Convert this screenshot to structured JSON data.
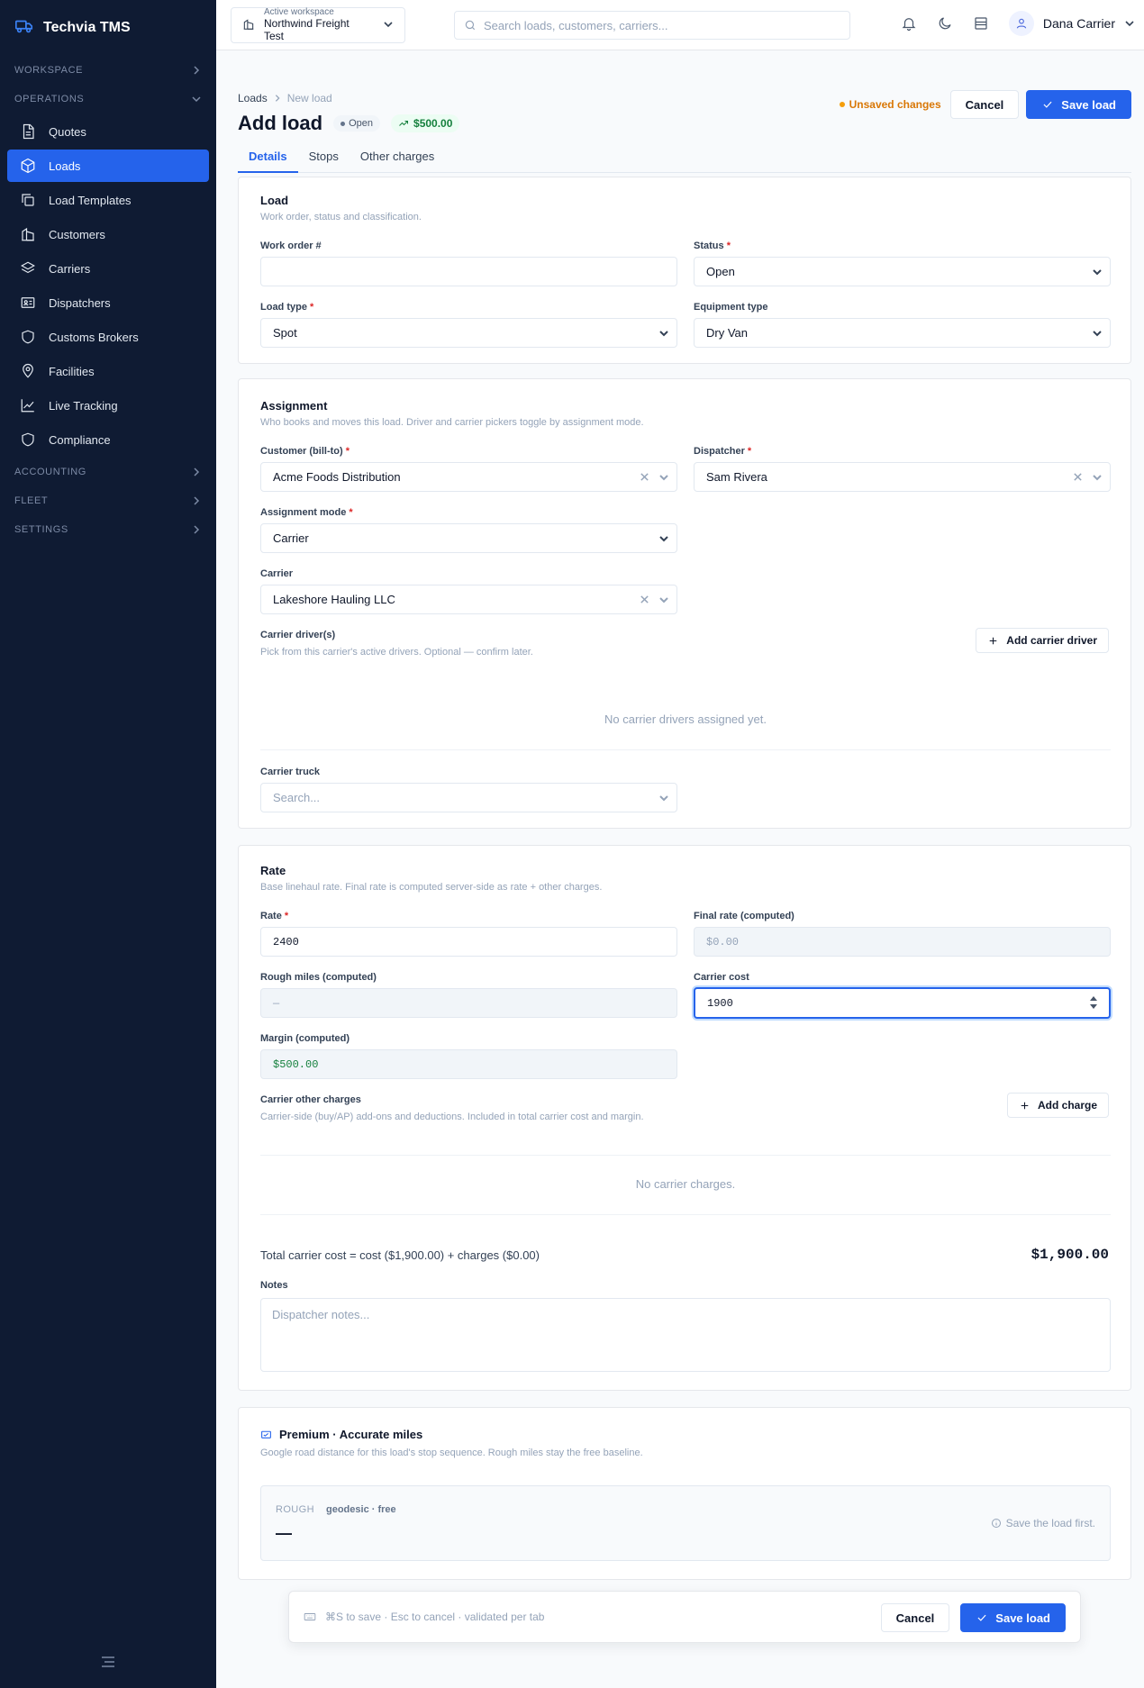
{
  "app": {
    "name": "Techvia TMS"
  },
  "colors": {
    "accent": "#2563eb",
    "sidebar_bg": "#0f1b33",
    "success": "#15803d",
    "warning": "#d97706",
    "required": "#dc2626"
  },
  "sidebar": {
    "sections": {
      "workspace": "WORKSPACE",
      "operations": "OPERATIONS",
      "accounting": "ACCOUNTING",
      "fleet": "FLEET",
      "settings": "SETTINGS"
    },
    "items": [
      {
        "label": "Quotes",
        "icon": "document-icon"
      },
      {
        "label": "Loads",
        "icon": "box-icon",
        "active": true
      },
      {
        "label": "Load Templates",
        "icon": "copy-icon"
      },
      {
        "label": "Customers",
        "icon": "building-icon"
      },
      {
        "label": "Carriers",
        "icon": "layers-icon"
      },
      {
        "label": "Dispatchers",
        "icon": "id-card-icon"
      },
      {
        "label": "Customs Brokers",
        "icon": "shield-icon"
      },
      {
        "label": "Facilities",
        "icon": "map-pin-icon"
      },
      {
        "label": "Live Tracking",
        "icon": "chart-line-icon"
      },
      {
        "label": "Compliance",
        "icon": "shield-icon"
      }
    ]
  },
  "topbar": {
    "workspace_caption": "Active workspace",
    "workspace_name": "Northwind Freight Test",
    "search_placeholder": "Search loads, customers, carriers...",
    "user_name": "Dana Carrier"
  },
  "header": {
    "breadcrumb_root": "Loads",
    "breadcrumb_current": "New load",
    "title": "Add load",
    "status_badge": "Open",
    "margin_badge": "$500.00",
    "unsaved": "Unsaved changes",
    "cancel": "Cancel",
    "save": "Save load"
  },
  "tabs": [
    "Details",
    "Stops",
    "Other charges"
  ],
  "load_section": {
    "title": "Load",
    "subtitle": "Work order, status and classification.",
    "work_order_label": "Work order #",
    "work_order_value": "",
    "status_label": "Status",
    "status_value": "Open",
    "load_type_label": "Load type",
    "load_type_value": "Spot",
    "equipment_label": "Equipment type",
    "equipment_value": "Dry Van"
  },
  "assignment": {
    "title": "Assignment",
    "subtitle": "Who books and moves this load. Driver and carrier pickers toggle by assignment mode.",
    "customer_label": "Customer (bill-to)",
    "customer_value": "Acme Foods Distribution",
    "dispatcher_label": "Dispatcher",
    "dispatcher_value": "Sam Rivera",
    "mode_label": "Assignment mode",
    "mode_value": "Carrier",
    "carrier_label": "Carrier",
    "carrier_value": "Lakeshore Hauling LLC",
    "drivers_label": "Carrier driver(s)",
    "drivers_hint": "Pick from this carrier's active drivers. Optional — confirm later.",
    "add_driver": "Add carrier driver",
    "drivers_empty": "No carrier drivers assigned yet.",
    "truck_label": "Carrier truck",
    "truck_placeholder": "Search..."
  },
  "rate": {
    "title": "Rate",
    "subtitle": "Base linehaul rate. Final rate is computed server-side as rate + other charges.",
    "rate_label": "Rate",
    "rate_value": "2400",
    "final_label": "Final rate (computed)",
    "final_value": "$0.00",
    "miles_label": "Rough miles (computed)",
    "miles_value": "—",
    "cost_label": "Carrier cost",
    "cost_value": "1900",
    "margin_label": "Margin (computed)",
    "margin_value": "$500.00",
    "charges_label": "Carrier other charges",
    "charges_hint": "Carrier-side (buy/AP) add-ons and deductions. Included in total carrier cost and margin.",
    "add_charge": "Add charge",
    "charges_empty": "No carrier charges.",
    "total_line": "Total carrier cost = cost ($1,900.00) + charges ($0.00)",
    "total_value": "$1,900.00",
    "notes_label": "Notes",
    "notes_placeholder": "Dispatcher notes..."
  },
  "premium": {
    "title": "Premium · Accurate miles",
    "subtitle": "Google road distance for this load's stop sequence. Rough miles stay the free baseline.",
    "rough_tag": "ROUGH",
    "geo_tag": "geodesic · free",
    "rough_value": "—",
    "save_first": "Save the load first."
  },
  "bottom_bar": {
    "hint": "⌘S to save · Esc to cancel · validated per tab",
    "cancel": "Cancel",
    "save": "Save load"
  }
}
